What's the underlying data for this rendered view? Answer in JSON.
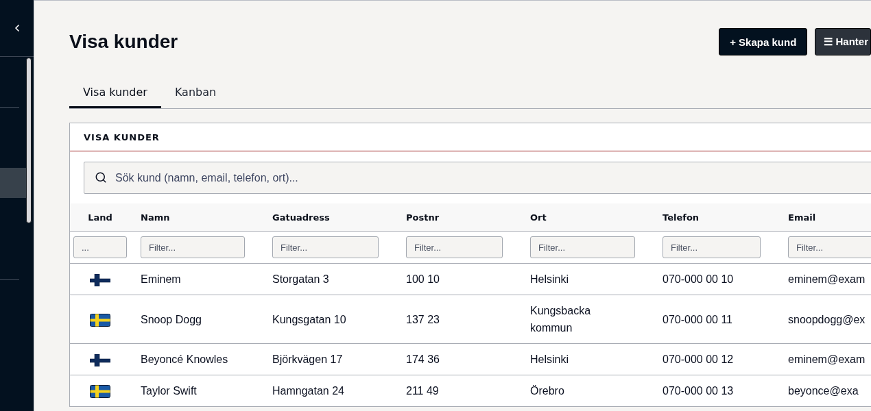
{
  "sidebar": {
    "items": [
      {
        "selected": false
      },
      {
        "selected": false
      },
      {
        "selected": true
      },
      {
        "selected": false
      },
      {
        "selected": false
      }
    ]
  },
  "page": {
    "title": "Visa kunder",
    "actions": [
      {
        "kind": "primary",
        "label": "+ Skapa kund"
      },
      {
        "kind": "secondary",
        "label": "☰ Hanter"
      }
    ]
  },
  "tabs": [
    {
      "label": "Visa kunder",
      "selected": true
    },
    {
      "label": "Kanban",
      "selected": false
    }
  ],
  "panel": {
    "title": "VISA KUNDER",
    "search": {
      "placeholder": "Sök kund (namn, email, telefon, ort)..."
    }
  },
  "table": {
    "columns": [
      {
        "label": "Land",
        "filter_placeholder": "..."
      },
      {
        "label": "Namn",
        "filter_placeholder": "Filter..."
      },
      {
        "label": "Gatuadress",
        "filter_placeholder": "Filter..."
      },
      {
        "label": "Postnr",
        "filter_placeholder": "Filter..."
      },
      {
        "label": "Ort",
        "filter_placeholder": "Filter..."
      },
      {
        "label": "Telefon",
        "filter_placeholder": "Filter..."
      },
      {
        "label": "Email",
        "filter_placeholder": "Filter..."
      }
    ],
    "rows": [
      {
        "kind": "finland",
        "cells": [
          "",
          "Eminem",
          "Storgatan 3",
          "100 10",
          "Helsinki",
          "070-000 00 10",
          "eminem@exam"
        ]
      },
      {
        "kind": "sweden",
        "cells": [
          "",
          "Snoop Dogg",
          "Kungsgatan 10",
          "137 23",
          "Kungsbacka kommun",
          "070-000 00 11",
          "snoopdogg@ex"
        ]
      },
      {
        "kind": "finland",
        "cells": [
          "",
          "Beyoncé Knowles",
          "Björkvägen 17",
          "174 36",
          "Helsinki",
          "070-000 00 12",
          "eminem@exam"
        ]
      },
      {
        "kind": "sweden",
        "cells": [
          "",
          "Taylor Swift",
          "Hamngatan 24",
          "211 49",
          "Örebro",
          "070-000 00 13",
          "beyonce@exa"
        ]
      }
    ]
  }
}
